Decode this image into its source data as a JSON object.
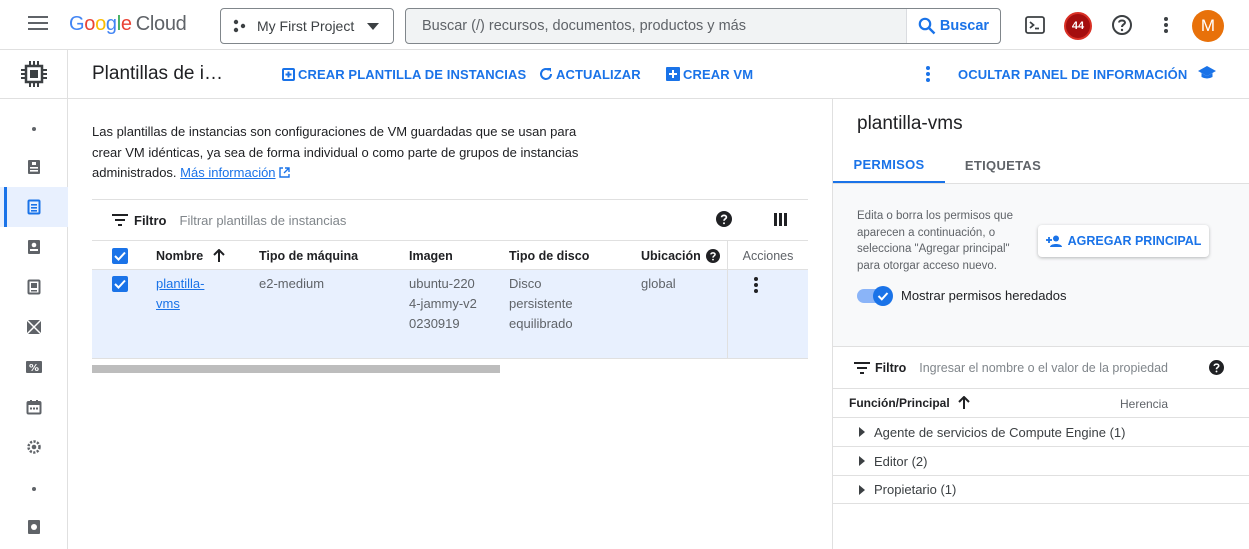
{
  "topbar": {
    "logo_google": "Google",
    "logo_cloud": "Cloud",
    "project_name": "My First Project",
    "search_placeholder": "Buscar (/) recursos, documentos, productos y más",
    "search_button": "Buscar",
    "notifications_count": "44",
    "avatar_letter": "M"
  },
  "page": {
    "title": "Plantillas de i…",
    "actions": {
      "create_template": "CREAR PLANTILLA DE INSTANCIAS",
      "refresh": "ACTUALIZAR",
      "create_vm": "CREAR VM",
      "hide_panel": "OCULTAR PANEL DE INFORMACIÓN"
    }
  },
  "intro": {
    "text": "Las plantillas de instancias son configuraciones de VM guardadas que se usan para crear VM idénticas, ya sea de forma individual o como parte de grupos de instancias administrados.",
    "link": "Más información"
  },
  "filter": {
    "label": "Filtro",
    "placeholder": "Filtrar plantillas de instancias"
  },
  "table": {
    "headers": {
      "name": "Nombre",
      "machine_type": "Tipo de máquina",
      "image": "Imagen",
      "disk_type": "Tipo de disco",
      "location": "Ubicación",
      "actions": "Acciones"
    },
    "rows": [
      {
        "name": "plantilla-vms",
        "machine_type": "e2-medium",
        "image": "ubuntu-2204-jammy-v20230919",
        "disk_type": "Disco persistente equilibrado",
        "location": "global"
      }
    ]
  },
  "panel": {
    "title": "plantilla-vms",
    "tabs": [
      "PERMISOS",
      "ETIQUETAS"
    ],
    "description": "Edita o borra los permisos que aparecen a continuación, o selecciona \"Agregar principal\" para otorgar acceso nuevo.",
    "add_principal": "AGREGAR PRINCIPAL",
    "toggle_label": "Mostrar permisos heredados",
    "filter_label": "Filtro",
    "filter_placeholder": "Ingresar el nombre o el valor de la propiedad",
    "col_role": "Función/Principal",
    "col_inheritance": "Herencia",
    "roles": [
      "Agente de servicios de Compute Engine (1)",
      "Editor (2)",
      "Propietario (1)"
    ]
  },
  "colors": {
    "accent": "#1a73e8",
    "badge": "#a50e0e",
    "avatar": "#e8710a",
    "row_selected": "#e8f0fe"
  }
}
